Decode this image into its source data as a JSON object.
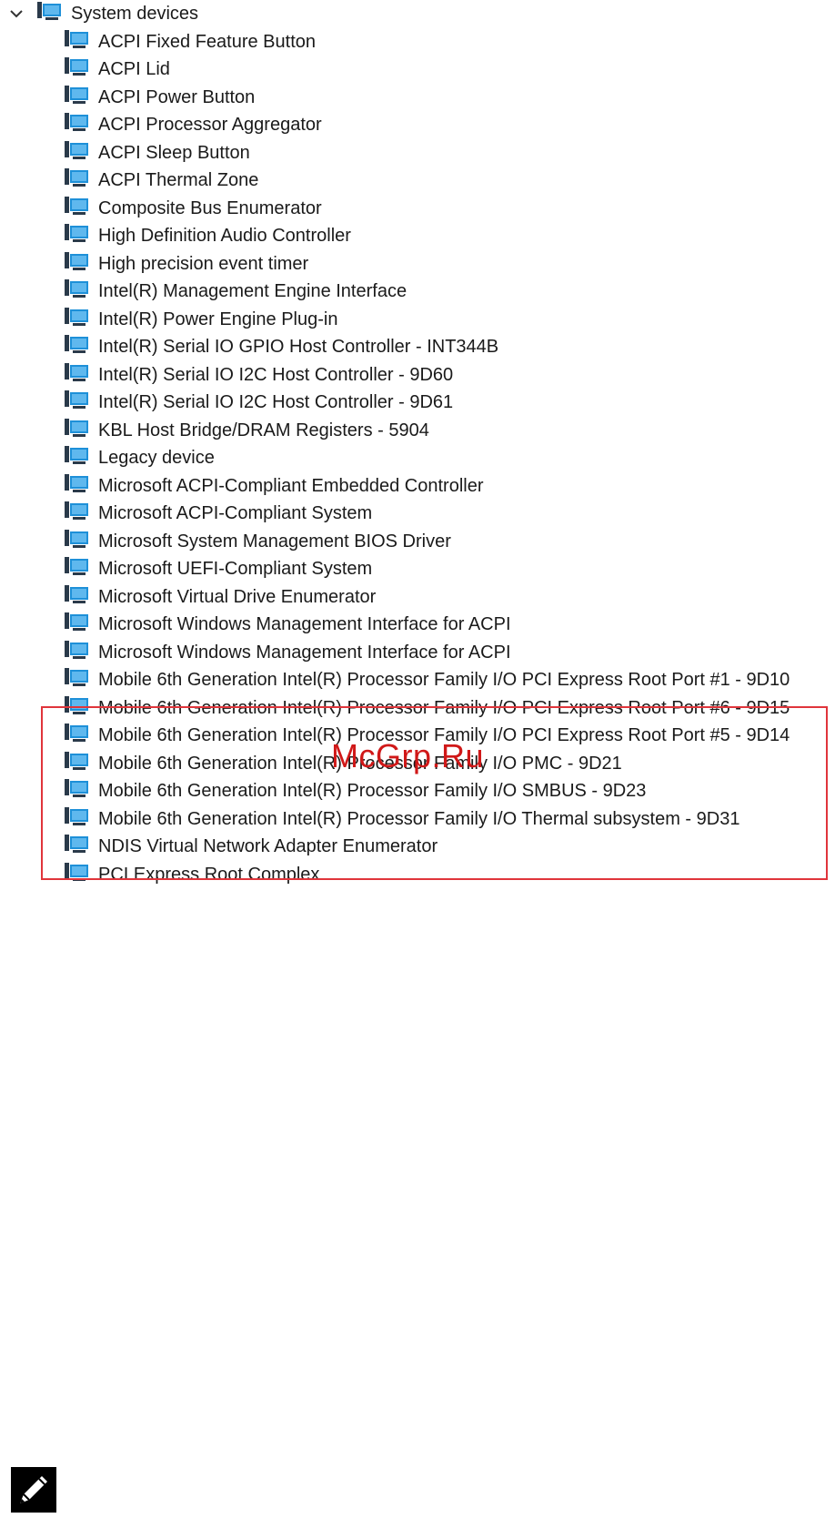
{
  "root": {
    "label": "System devices",
    "icon": "computer-device-icon",
    "expanded": true
  },
  "devices": [
    "ACPI Fixed Feature Button",
    "ACPI Lid",
    "ACPI Power Button",
    "ACPI Processor Aggregator",
    "ACPI Sleep Button",
    "ACPI Thermal Zone",
    "Composite Bus Enumerator",
    "High Definition Audio Controller",
    "High precision event timer",
    "Intel(R) Management Engine Interface",
    "Intel(R) Power Engine Plug-in",
    "Intel(R) Serial IO GPIO Host Controller - INT344B",
    "Intel(R) Serial IO I2C Host Controller - 9D60",
    "Intel(R) Serial IO I2C Host Controller - 9D61",
    "KBL Host Bridge/DRAM Registers - 5904",
    "Legacy device",
    "Microsoft ACPI-Compliant Embedded Controller",
    "Microsoft ACPI-Compliant System",
    "Microsoft System Management BIOS Driver",
    "Microsoft UEFI-Compliant System",
    "Microsoft Virtual Drive Enumerator",
    "Microsoft Windows Management Interface for ACPI",
    "Microsoft Windows Management Interface for ACPI",
    "Mobile 6th Generation Intel(R) Processor Family I/O PCI Express Root Port #1 - 9D10",
    "Mobile 6th Generation Intel(R) Processor Family I/O PCI Express Root Port #6 - 9D15",
    "Mobile 6th Generation Intel(R) Processor Family I/O PCI Express Root Port #5 - 9D14",
    "Mobile 6th Generation Intel(R) Processor Family I/O PMC - 9D21",
    "Mobile 6th Generation Intel(R) Processor Family I/O SMBUS - 9D23",
    "Mobile 6th Generation Intel(R) Processor Family I/O Thermal subsystem - 9D31",
    "NDIS Virtual Network Adapter Enumerator",
    "PCI Express Root Complex"
  ],
  "highlight": {
    "color": "#e0353b"
  },
  "watermark": "McGrp.Ru",
  "note_icon": "pencil-note-icon",
  "colors": {
    "icon_blue": "#1e90d8",
    "icon_dark": "#2a3a4a"
  }
}
